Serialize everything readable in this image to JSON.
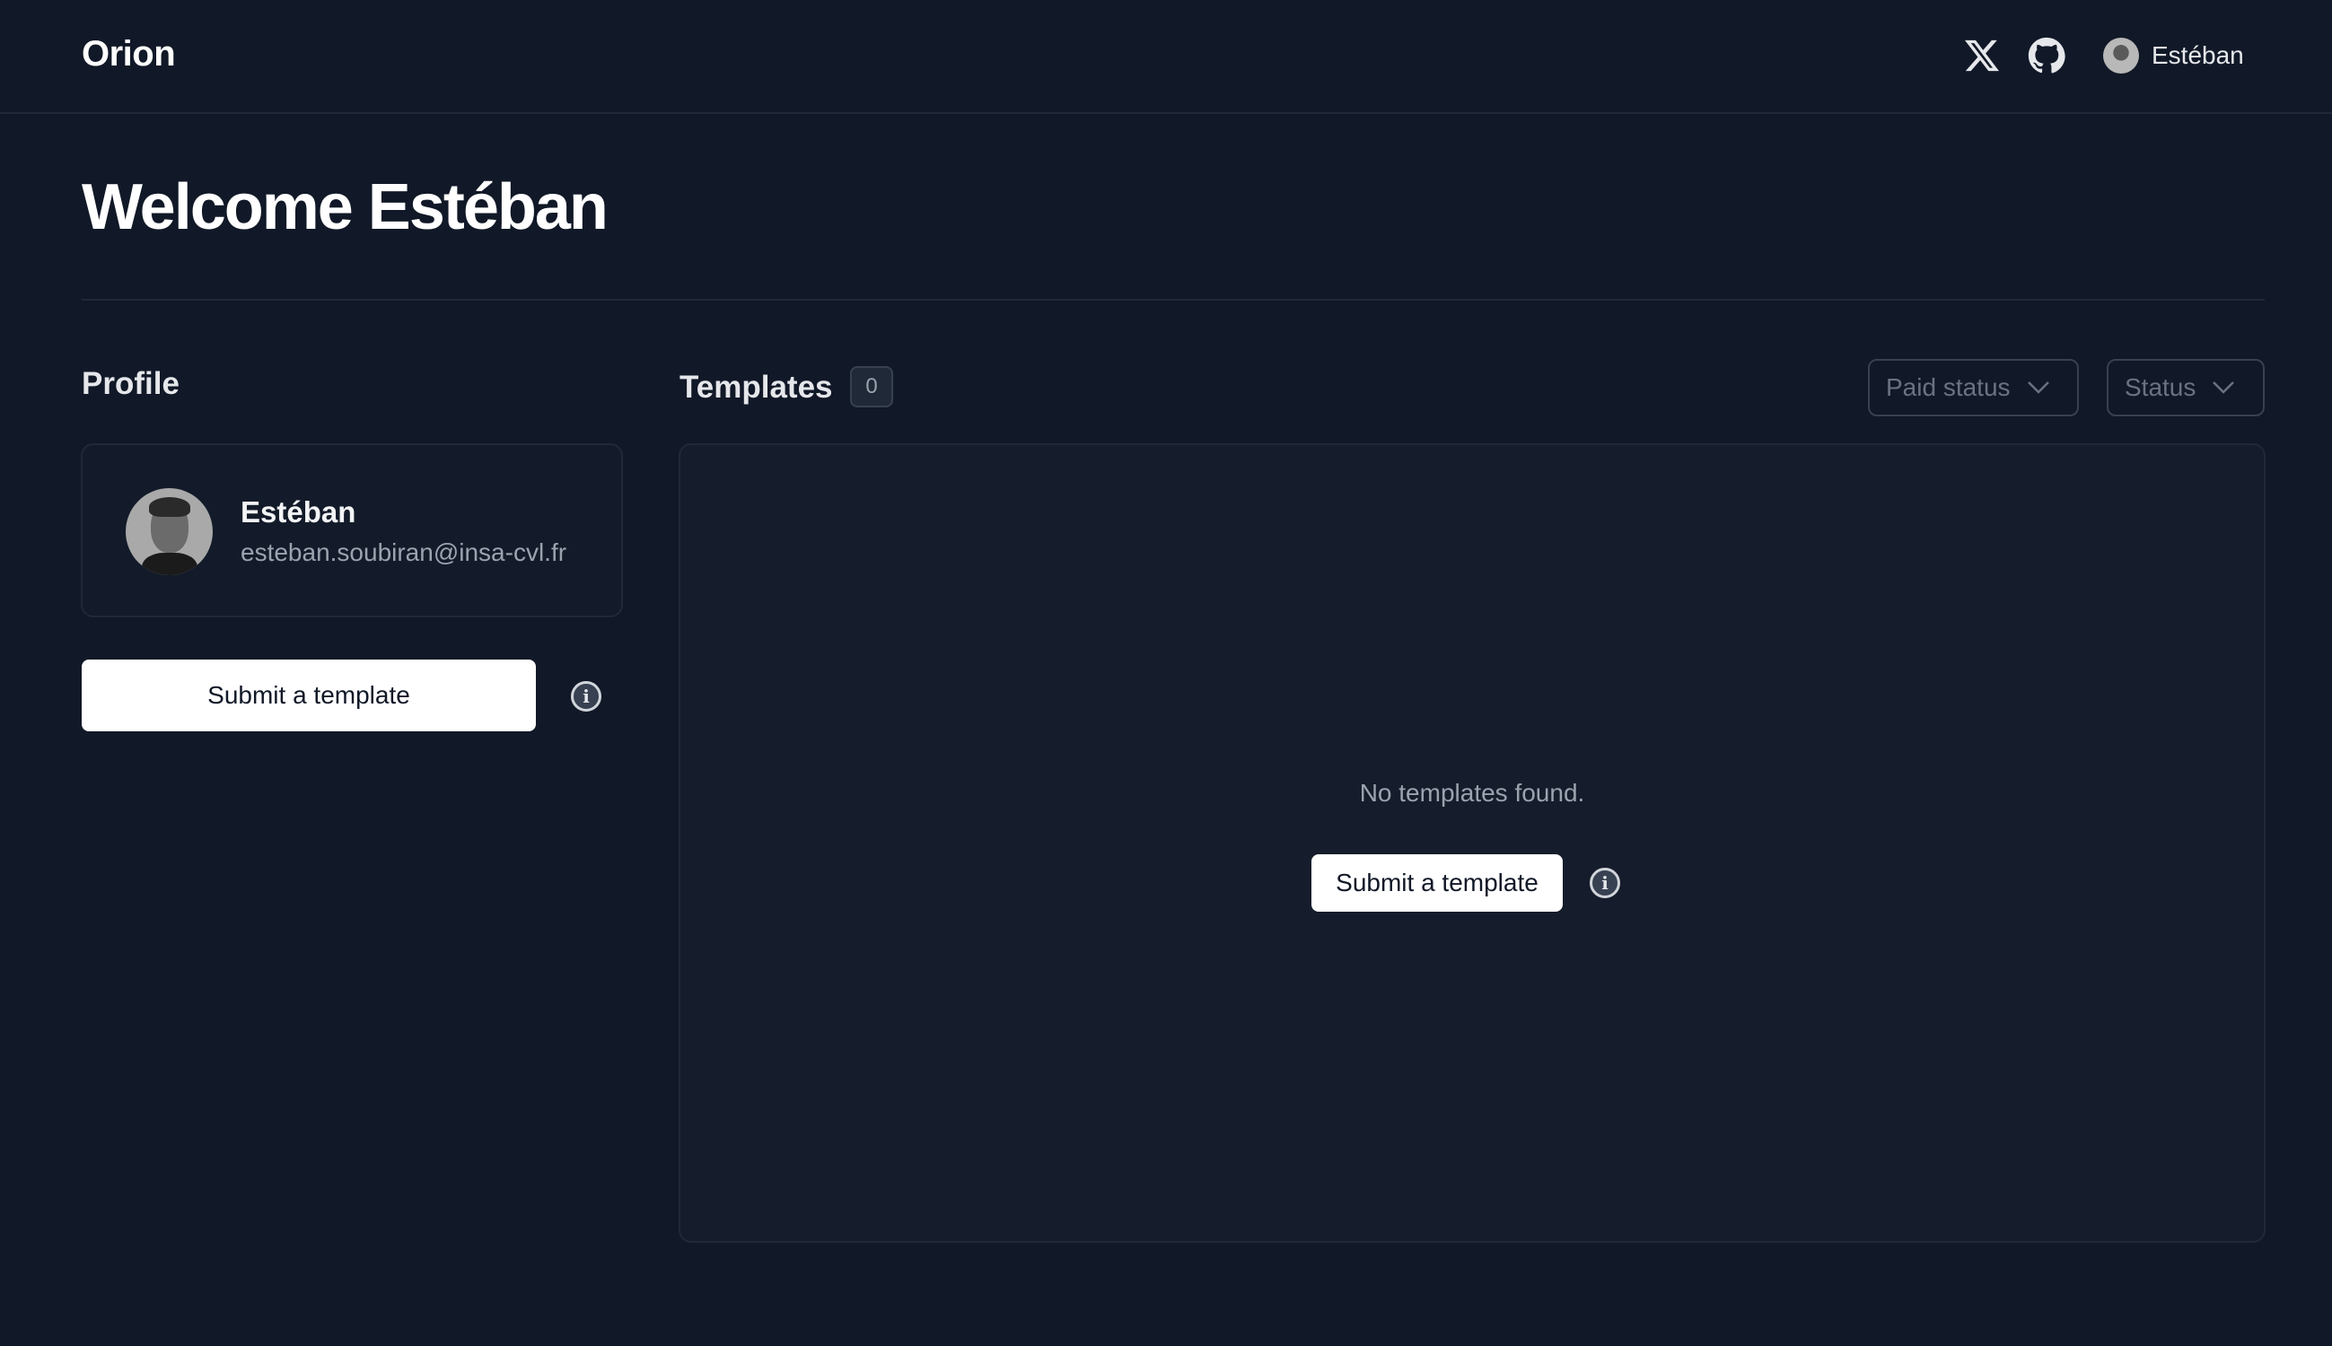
{
  "header": {
    "logo": "Orion",
    "icons": [
      {
        "name": "x-twitter-icon",
        "label": "X"
      },
      {
        "name": "github-icon",
        "label": "GitHub"
      }
    ],
    "user": {
      "name": "Estéban"
    }
  },
  "page": {
    "title": "Welcome Estéban"
  },
  "profile": {
    "heading": "Profile",
    "name": "Estéban",
    "email": "esteban.soubiran@insa-cvl.fr",
    "submit_label": "Submit a template"
  },
  "templates": {
    "heading": "Templates",
    "count": "0",
    "filters": {
      "paid_status": "Paid status",
      "status": "Status"
    },
    "empty_message": "No templates found.",
    "submit_label": "Submit a template"
  },
  "colors": {
    "background": "#111827",
    "panel": "#151c2b",
    "border": "#1f2937",
    "text_primary": "#ffffff",
    "text_muted": "#9ca3af"
  }
}
